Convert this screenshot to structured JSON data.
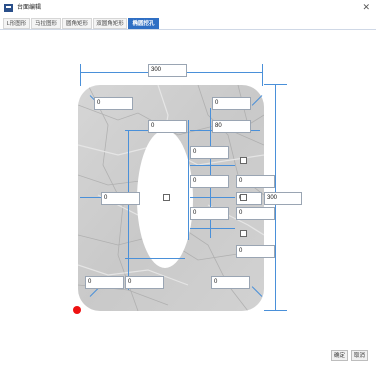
{
  "window": {
    "title": "台面编辑",
    "close_icon": "close-icon"
  },
  "tabs": [
    {
      "label": "L形图形"
    },
    {
      "label": "马拉图形"
    },
    {
      "label": "圆角矩形"
    },
    {
      "label": "双圆角矩形"
    },
    {
      "label": "椭圆挖孔",
      "active": true
    }
  ],
  "dimensions": {
    "width": "300",
    "height": "300",
    "corner_tl": "0",
    "corner_tr": "0",
    "corner_bl": "0",
    "corner_br": "0",
    "hole_left": "0",
    "hole_top": "0",
    "hole_width": "80",
    "hole_bottom": "0",
    "hole_radius_top": "0",
    "hole_radius_bottom": "0",
    "right_col_1": "0",
    "right_col_2": "0",
    "right_col_3": "0",
    "right_col_4": "0",
    "right_col_5": "0",
    "right_col_6": "0",
    "right_col_7": "0"
  },
  "buttons": {
    "ok": "确定",
    "cancel": "取消"
  },
  "colors": {
    "accent": "#2f6fc4",
    "dimension_line": "#4a90d9",
    "marker": "#ee1111"
  }
}
